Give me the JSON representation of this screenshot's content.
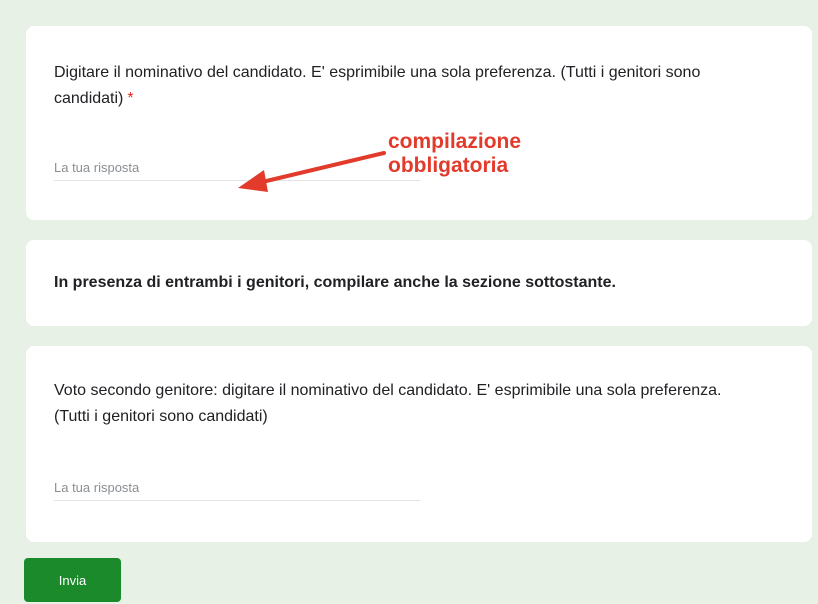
{
  "questions": {
    "q1": {
      "text": "Digitare il nominativo del candidato. E' esprimibile una sola preferenza. (Tutti i genitori sono candidati)",
      "required_mark": "*",
      "placeholder": "La tua risposta"
    },
    "section": {
      "text": "In presenza di entrambi i genitori, compilare anche la sezione sottostante."
    },
    "q2": {
      "text": "Voto secondo genitore: digitare il nominativo del candidato. E' esprimibile una sola preferenza. (Tutti i genitori sono candidati)",
      "placeholder": "La tua risposta"
    }
  },
  "annotation": {
    "line1": "compilazione",
    "line2": "obbligatoria",
    "color": "#e23b2c"
  },
  "submit": {
    "label": "Invia",
    "color": "#1a8a2a"
  },
  "colors": {
    "background": "#e8f1e6",
    "required": "#d93025"
  }
}
